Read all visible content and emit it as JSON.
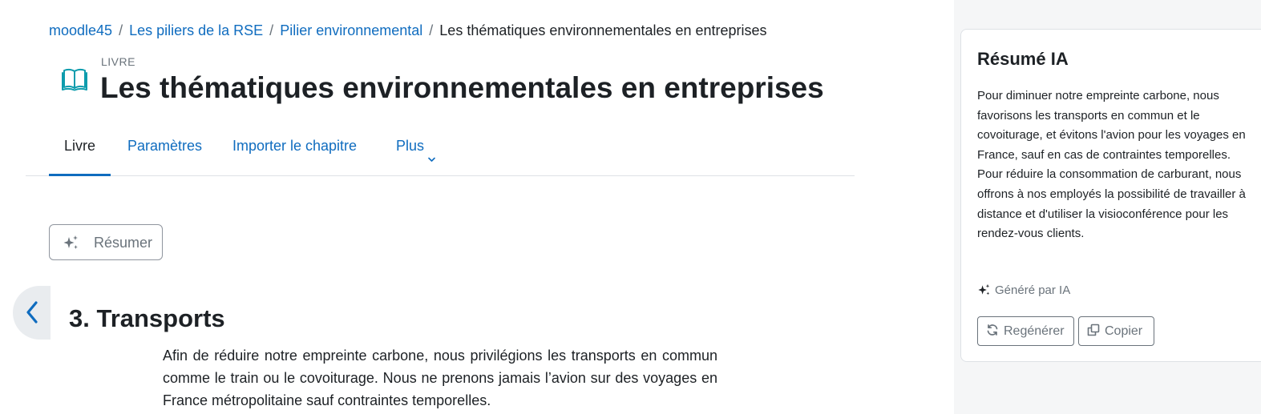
{
  "breadcrumb": {
    "items": [
      "moodle45",
      "Les piliers de la RSE",
      "Pilier environnemental"
    ],
    "current": "Les thématiques environnementales en entreprises",
    "separator": "/"
  },
  "header": {
    "module_type": "LIVRE",
    "title": "Les thématiques environnementales en entreprises",
    "icon": "book-icon"
  },
  "tabs": [
    {
      "label": "Livre",
      "active": true
    },
    {
      "label": "Paramètres",
      "active": false
    },
    {
      "label": "Importer le chapitre",
      "active": false
    },
    {
      "label": "Plus",
      "active": false,
      "has_dropdown": true
    }
  ],
  "actions": {
    "summarize_label": "Résumer",
    "summarize_icon": "sparkle-icon"
  },
  "chapter": {
    "title": "3. Transports",
    "text": "Afin de réduire notre empreinte carbone, nous privilégions les transports en commun comme le train ou le covoiturage. Nous ne prenons jamais l’avion sur des voyages en France métropolitaine sauf contraintes temporelles."
  },
  "ai_summary": {
    "title": "Résumé IA",
    "text": "Pour diminuer notre empreinte carbone, nous favorisons les transports en commun et le covoiturage, et évitons l'avion pour les voyages en France, sauf en cas de contraintes temporelles. Pour réduire la consommation de carburant, nous offrons à nos employés la possibilité de travailler à distance et d'utiliser la visioconférence pour les rendez-vous clients.",
    "generated_by": "Généré par IA",
    "regenerate_label": "Regénérer",
    "copy_label": "Copier"
  },
  "colors": {
    "link": "#0f6cbf",
    "text": "#1d2125",
    "muted": "#6a737b",
    "icon_teal": "#0d9cad",
    "drawer_bg": "#f5f6f7"
  }
}
